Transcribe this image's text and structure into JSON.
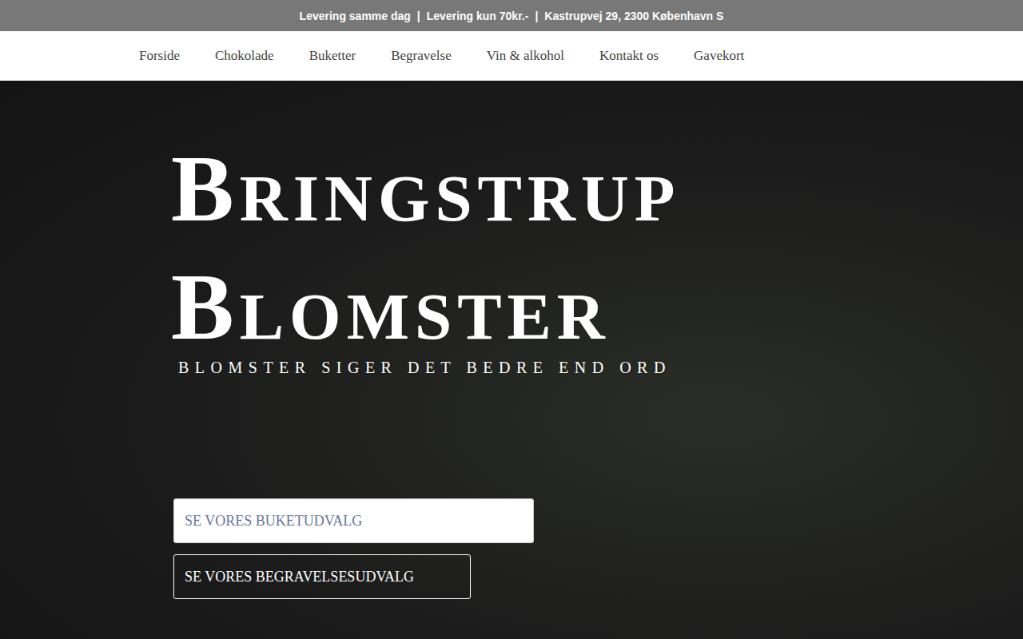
{
  "top_bar": {
    "items": [
      "Levering samme dag",
      "Levering kun 70kr.-",
      "Kastrupvej 29, 2300 København S"
    ],
    "separator": "|"
  },
  "nav": {
    "items": [
      {
        "label": "Forside"
      },
      {
        "label": "Chokolade"
      },
      {
        "label": "Buketter"
      },
      {
        "label": "Begravelse"
      },
      {
        "label": "Vin & alkohol"
      },
      {
        "label": "Kontakt os"
      },
      {
        "label": "Gavekort"
      }
    ]
  },
  "hero": {
    "title_lines": [
      "Bringstrup",
      "Blomster"
    ],
    "tagline": "BLOMSTER SIGER DET BEDRE END ORD",
    "buttons": [
      {
        "label": "SE VORES BUKETUDVALG",
        "kind": "filled"
      },
      {
        "label": "SE VORES BEGRAVELSESUDVALG",
        "kind": "outline"
      }
    ]
  }
}
